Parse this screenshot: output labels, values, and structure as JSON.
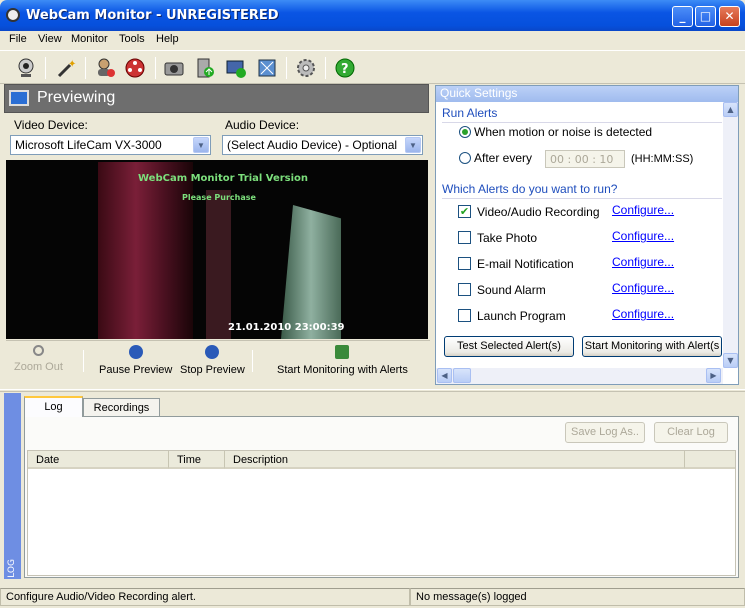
{
  "window": {
    "title": "WebCam Monitor - UNREGISTERED"
  },
  "menu": [
    "File",
    "View",
    "Monitor",
    "Tools",
    "Help"
  ],
  "toolbar": {
    "icons": [
      "webcam-icon",
      "wizard-icon",
      "user-settings-icon",
      "film-reel-icon",
      "camera-icon",
      "upload-icon",
      "email-icon",
      "network-icon",
      "gear-icon",
      "help-icon"
    ]
  },
  "preview": {
    "title": "Previewing",
    "video_device_label": "Video Device:",
    "video_device_value": "Microsoft LifeCam VX-3000",
    "audio_device_label": "Audio Device:",
    "audio_device_value": "(Select Audio Device) - Optional",
    "overlay_title": "WebCam Monitor Trial Version",
    "overlay_sub": "Please Purchase",
    "timestamp": "21.01.2010 23:00:39",
    "buttons": {
      "zoom_out": "Zoom Out",
      "pause": "Pause Preview",
      "stop": "Stop Preview",
      "start_monitoring": "Start Monitoring with Alerts"
    }
  },
  "quick_settings": {
    "title": "Quick Settings",
    "run_alerts_heading": "Run Alerts",
    "option_motion": "When motion or noise is detected",
    "option_after_every": "After every",
    "interval_value": "00 : 00 : 10",
    "interval_format": "(HH:MM:SS)",
    "which_alerts_heading": "Which Alerts do you want to run?",
    "alerts": [
      {
        "label": "Video/Audio Recording",
        "checked": true,
        "link": "Configure..."
      },
      {
        "label": "Take Photo",
        "checked": false,
        "link": "Configure..."
      },
      {
        "label": "E-mail Notification",
        "checked": false,
        "link": "Configure..."
      },
      {
        "label": "Sound Alarm",
        "checked": false,
        "link": "Configure..."
      },
      {
        "label": "Launch Program",
        "checked": false,
        "link": "Configure..."
      }
    ],
    "test_button": "Test Selected Alert(s)",
    "start_button": "Start Monitoring with Alert(s"
  },
  "log": {
    "side_label": "LOG",
    "tabs": [
      "Log",
      "Recordings"
    ],
    "active_tab": "Log",
    "save_button": "Save Log As..",
    "clear_button": "Clear Log",
    "columns": [
      "Date",
      "Time",
      "Description"
    ]
  },
  "status": {
    "left": "Configure Audio/Video Recording alert.",
    "right": "No message(s) logged"
  },
  "colors": {
    "titlebar": "#0a55e4",
    "panel_header": "#6e6e6e",
    "quick_settings_header": "#9fbbee",
    "link": "#0000ff"
  }
}
